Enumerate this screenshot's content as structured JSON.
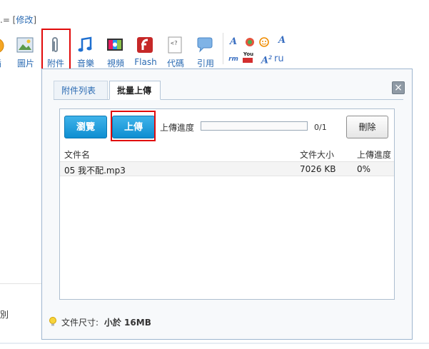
{
  "header": {
    "prefix": ".= [",
    "edit_link": "修改",
    "suffix": "]"
  },
  "toolbar": {
    "items": [
      {
        "label": "插"
      },
      {
        "label": "圖片"
      },
      {
        "label": "附件"
      },
      {
        "label": "音樂"
      },
      {
        "label": "視頻"
      },
      {
        "label": "Flash"
      },
      {
        "label": "代碼"
      },
      {
        "label": "引用"
      }
    ],
    "small_icons": {
      "youtube_text": "You"
    }
  },
  "left_area": {
    "label": "別"
  },
  "dialog": {
    "tabs": [
      {
        "label": "附件列表",
        "active": false
      },
      {
        "label": "批量上傳",
        "active": true
      }
    ],
    "close_symbol": "×",
    "browse_label": "瀏覽",
    "upload_label": "上傳",
    "progress_label": "上傳進度",
    "progress_fraction": 0,
    "progress_count": "0/1",
    "delete_label": "刪除",
    "table": {
      "headers": [
        "文件名",
        "文件大小",
        "上傳進度"
      ],
      "rows": [
        {
          "name": "05 我不配.mp3",
          "size": "7026 KB",
          "progress": "0%"
        }
      ]
    },
    "size_hint_label": "文件尺寸:",
    "size_hint_value": "小於 16MB"
  },
  "colors": {
    "accent_blue": "#0e8ed1",
    "highlight_red": "#e10a0a",
    "link": "#2b6bb3"
  }
}
